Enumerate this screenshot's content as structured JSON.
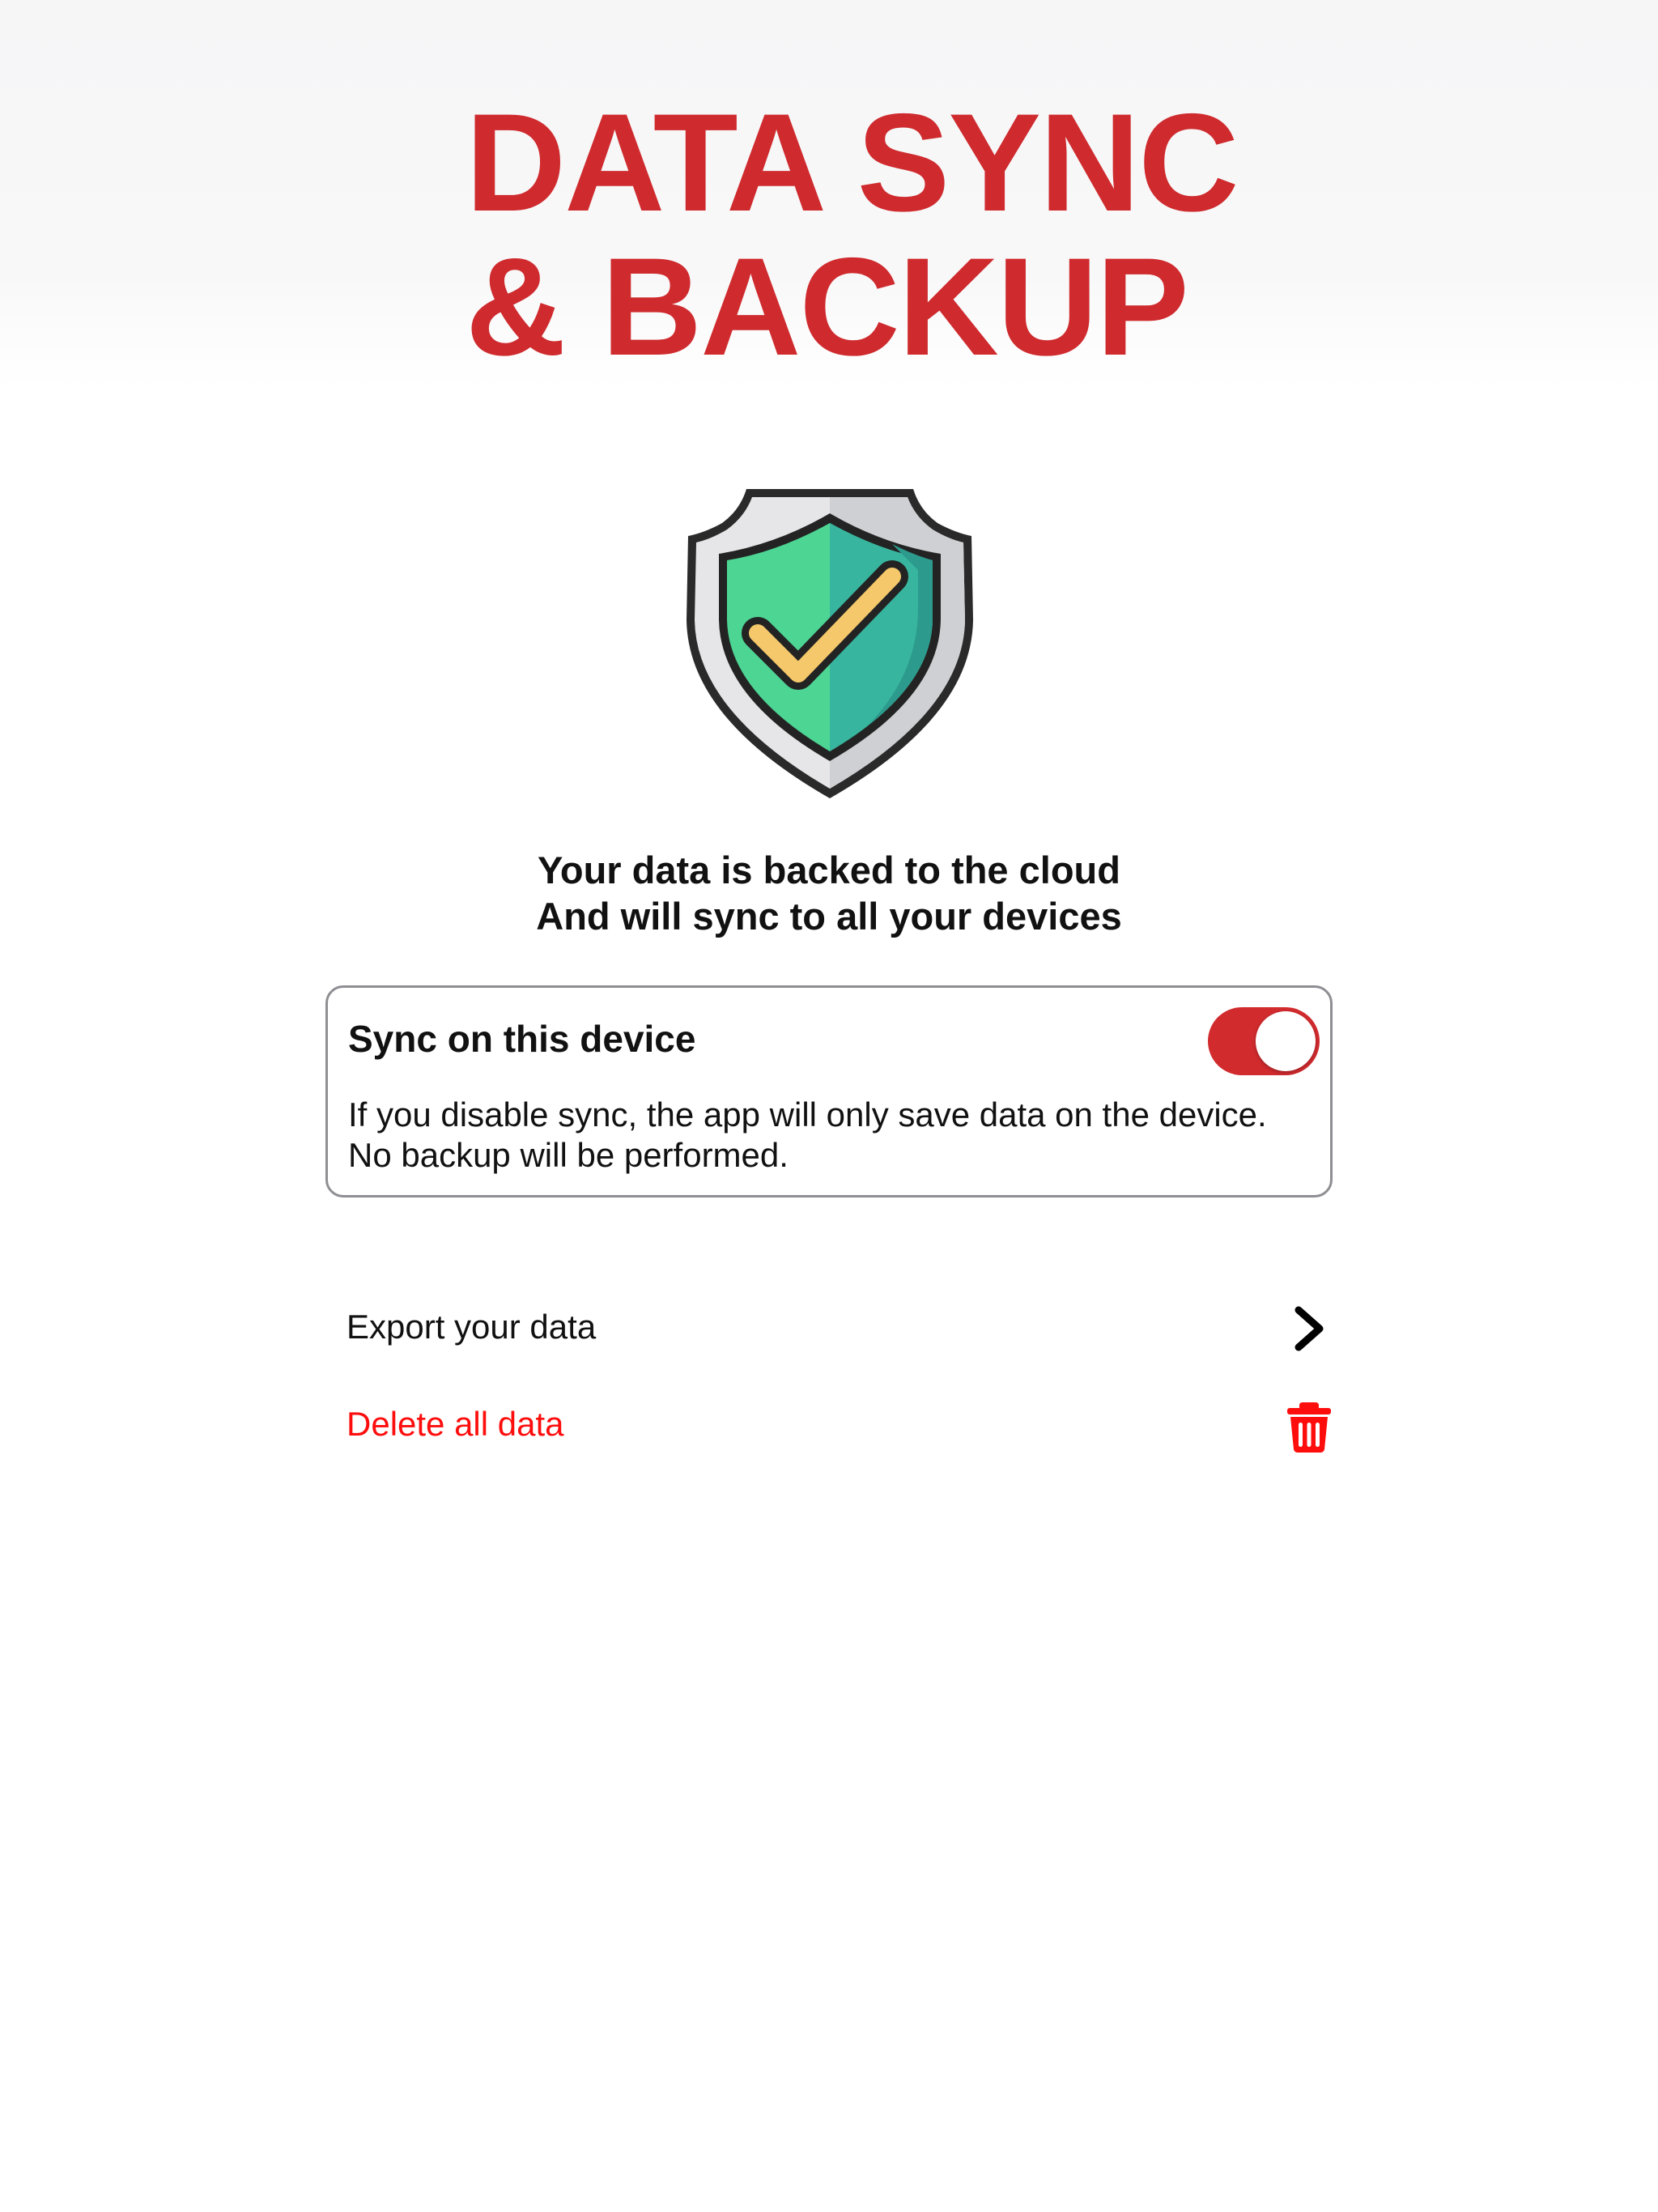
{
  "hero": {
    "title_line1": "DATA SYNC",
    "title_line2": "& BACKUP",
    "title_color": "#cf2b2e"
  },
  "status": {
    "icon": "shield-check-icon",
    "line1": "Your data is backed to the cloud",
    "line2": "And will sync to all your devices"
  },
  "sync_card": {
    "title": "Sync on this device",
    "toggle_on": true,
    "toggle_color": "#d12b2e",
    "description_line1": "If you disable sync, the app will only save data on the device.",
    "description_line2": "No backup will be performed."
  },
  "actions": {
    "export": {
      "label": "Export your data",
      "icon": "chevron-right-icon"
    },
    "delete": {
      "label": "Delete all data",
      "icon": "trash-icon",
      "color": "#fe0d0d"
    }
  }
}
